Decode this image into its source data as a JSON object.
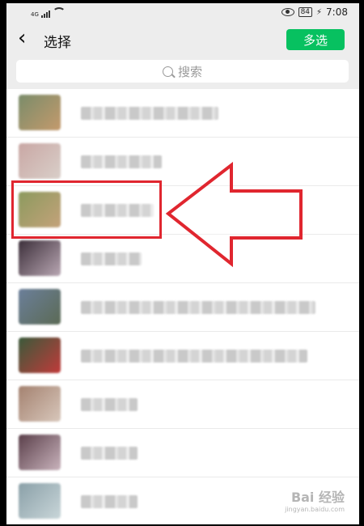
{
  "status": {
    "network": "4G",
    "battery": "84",
    "time": "7:08"
  },
  "header": {
    "back_icon": "chevron-left-icon",
    "title": "选择",
    "multi_select_label": "多选"
  },
  "search": {
    "placeholder": "搜索",
    "icon": "search-icon"
  },
  "contacts": [
    {
      "avatar_colors": [
        "#7a8c6a",
        "#c49a6c"
      ]
    },
    {
      "avatar_colors": [
        "#c9a7a4",
        "#d9cfc9"
      ]
    },
    {
      "avatar_colors": [
        "#8c9a5e",
        "#c4a27a"
      ]
    },
    {
      "avatar_colors": [
        "#3c2f3a",
        "#b9a7b3"
      ]
    },
    {
      "avatar_colors": [
        "#6b7f9a",
        "#5b6a55"
      ]
    },
    {
      "avatar_colors": [
        "#3a5a3a",
        "#c13a3a"
      ]
    },
    {
      "avatar_colors": [
        "#a48270",
        "#d8c7bb"
      ]
    },
    {
      "avatar_colors": [
        "#5a3f4a",
        "#c9b3bc"
      ]
    },
    {
      "avatar_colors": [
        "#8aa0a8",
        "#c9d6d9"
      ]
    }
  ],
  "colors": {
    "accent": "#07c160",
    "annotation": "#e0262f"
  },
  "watermark": {
    "main": "Bai 经验",
    "sub": "jingyan.baidu.com"
  }
}
